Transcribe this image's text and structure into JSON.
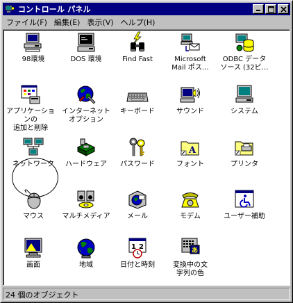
{
  "window": {
    "title": "コントロール パネル",
    "controls": {
      "minimize": "_",
      "maximize": "□",
      "close": "×"
    }
  },
  "menu": [
    {
      "label": "ファイル(F)"
    },
    {
      "label": "編集(E)"
    },
    {
      "label": "表示(V)"
    },
    {
      "label": "ヘルプ(H)"
    }
  ],
  "icons": [
    {
      "name": "98環境",
      "label": "98環境",
      "icon": "pc98-computer-icon"
    },
    {
      "name": "dos-env",
      "label": "DOS 環境",
      "icon": "dos-monitor-icon"
    },
    {
      "name": "find-fast",
      "label": "Find Fast",
      "icon": "binoculars-icon"
    },
    {
      "name": "ms-mail",
      "label": "Microsoft\nMail ポス…",
      "icon": "mail-post-icon"
    },
    {
      "name": "odbc",
      "label": "ODBC データ\nソース (32ビ…",
      "icon": "odbc-database-icon"
    },
    {
      "name": "add-remove",
      "label": "アプリケーションの\n追加と削除",
      "icon": "add-remove-programs-icon"
    },
    {
      "name": "internet",
      "label": "インターネット\nオプション",
      "icon": "globe-tools-icon"
    },
    {
      "name": "keyboard",
      "label": "キーボード",
      "icon": "keyboard-icon"
    },
    {
      "name": "sound",
      "label": "サウンド",
      "icon": "speaker-icon"
    },
    {
      "name": "system",
      "label": "システム",
      "icon": "computer-icon"
    },
    {
      "name": "network",
      "label": "ネットワーク",
      "icon": "network-icon"
    },
    {
      "name": "hardware",
      "label": "ハードウェア",
      "icon": "hardware-icon"
    },
    {
      "name": "password",
      "label": "パスワード",
      "icon": "keys-icon"
    },
    {
      "name": "fonts",
      "label": "フォント",
      "icon": "fonts-folder-icon"
    },
    {
      "name": "printers",
      "label": "プリンタ",
      "icon": "printer-folder-icon"
    },
    {
      "name": "mouse",
      "label": "マウス",
      "icon": "mouse-icon"
    },
    {
      "name": "multimedia",
      "label": "マルチメディア",
      "icon": "multimedia-icon"
    },
    {
      "name": "mail",
      "label": "メール",
      "icon": "mail-icon"
    },
    {
      "name": "modem",
      "label": "モデム",
      "icon": "telephone-icon"
    },
    {
      "name": "accessibility",
      "label": "ユーザー補助",
      "icon": "wheelchair-icon"
    },
    {
      "name": "display",
      "label": "画面",
      "icon": "display-icon"
    },
    {
      "name": "regional",
      "label": "地域",
      "icon": "earth-icon"
    },
    {
      "name": "datetime",
      "label": "日付と時刻",
      "icon": "calendar-clock-icon"
    },
    {
      "name": "ime-color",
      "label": "変換中の文\n字列の色",
      "icon": "ime-color-icon"
    }
  ],
  "status": {
    "text": "24 個のオブジェクト"
  }
}
